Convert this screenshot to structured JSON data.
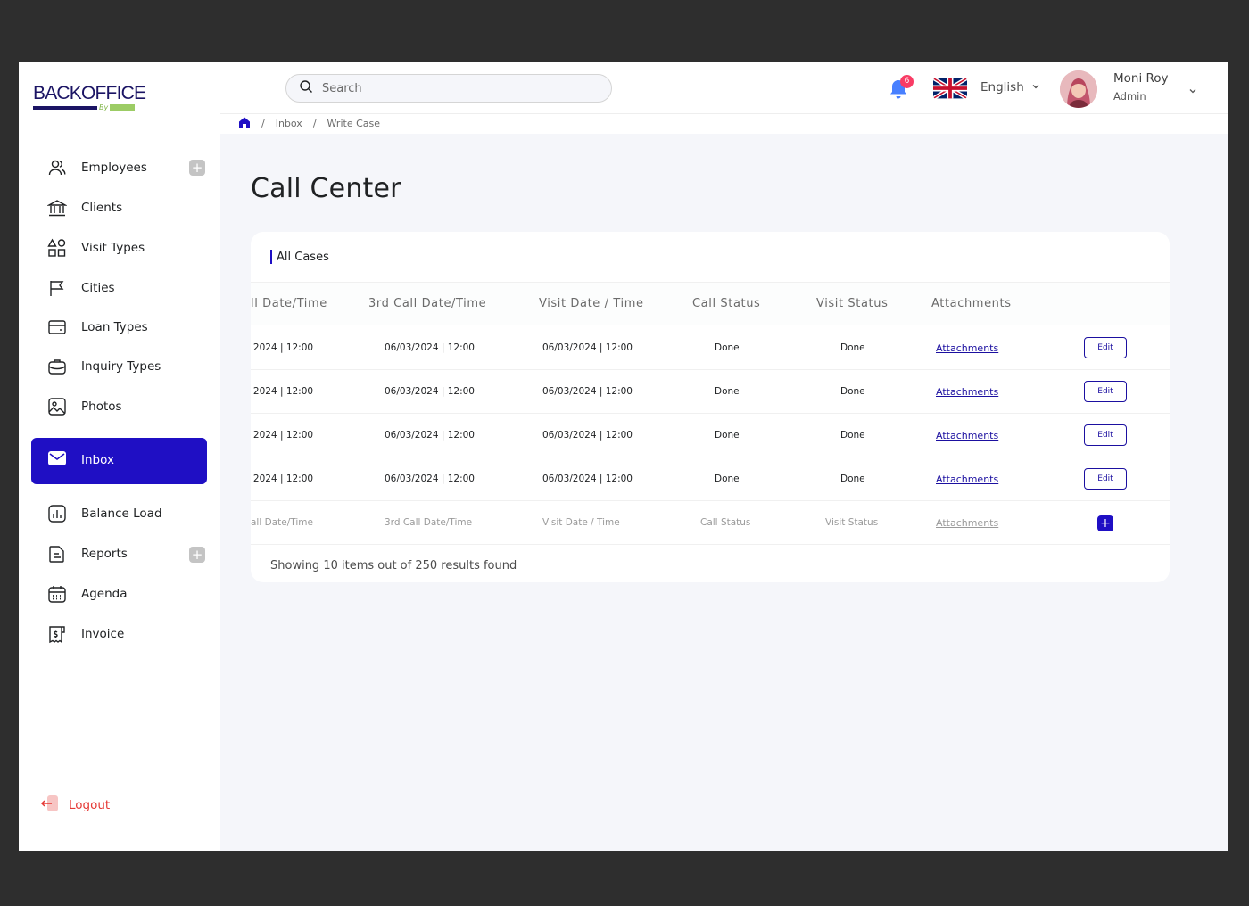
{
  "brand": {
    "name": "BACKOFFICE",
    "by": "By"
  },
  "colors": {
    "accent": "#1f0fc4",
    "link": "#1b0fa0",
    "logout": "#e53935",
    "badge": "#f93c65"
  },
  "sidebar": {
    "items": [
      {
        "label": "Employees",
        "icon": "users-icon",
        "has_plus": true
      },
      {
        "label": "Clients",
        "icon": "bank-icon",
        "has_plus": false
      },
      {
        "label": "Visit Types",
        "icon": "shapes-icon",
        "has_plus": false
      },
      {
        "label": "Cities",
        "icon": "flag-icon",
        "has_plus": false
      },
      {
        "label": "Loan Types",
        "icon": "wallet-icon",
        "has_plus": false
      },
      {
        "label": "Inquiry Types",
        "icon": "briefcase-icon",
        "has_plus": false
      },
      {
        "label": "Photos",
        "icon": "image-icon",
        "has_plus": false
      },
      {
        "label": "Inbox",
        "icon": "mail-icon",
        "active": true
      },
      {
        "label": "Balance Load",
        "icon": "chart-icon",
        "has_plus": false
      },
      {
        "label": "Reports",
        "icon": "document-icon",
        "has_plus": true
      },
      {
        "label": "Agenda",
        "icon": "calendar-icon",
        "has_plus": false
      },
      {
        "label": "Invoice",
        "icon": "invoice-icon",
        "has_plus": false
      }
    ],
    "plus_label": "+",
    "logout": "Logout"
  },
  "header": {
    "search_placeholder": "Search",
    "notifications": "6",
    "language": "English",
    "user_name": "Moni Roy",
    "user_role": "Admin"
  },
  "breadcrumb": {
    "items": [
      "Inbox",
      "Write Case"
    ],
    "separator": "/"
  },
  "page": {
    "title": "Call Center"
  },
  "table": {
    "title": "All Cases",
    "columns": [
      "ll Date/Time",
      "3rd Call Date/Time",
      "Visit Date / Time",
      "Call Status",
      "Visit Status",
      "Attachments"
    ],
    "rows": [
      [
        "'2024 | 12:00",
        "06/03/2024 | 12:00",
        "06/03/2024 | 12:00",
        "Done",
        "Done",
        "Attachments",
        "Edit"
      ],
      [
        "'2024 | 12:00",
        "06/03/2024 | 12:00",
        "06/03/2024 | 12:00",
        "Done",
        "Done",
        "Attachments",
        "Edit"
      ],
      [
        "'2024 | 12:00",
        "06/03/2024 | 12:00",
        "06/03/2024 | 12:00",
        "Done",
        "Done",
        "Attachments",
        "Edit"
      ],
      [
        "'2024 | 12:00",
        "06/03/2024 | 12:00",
        "06/03/2024 | 12:00",
        "Done",
        "Done",
        "Attachments",
        "Edit"
      ]
    ],
    "placeholder_row": [
      "all Date/Time",
      "3rd Call Date/Time",
      "Visit Date / Time",
      "Call Status",
      "Visit Status",
      "Attachments",
      "+"
    ],
    "footer": "Showing 10 items out of 250 results found"
  }
}
